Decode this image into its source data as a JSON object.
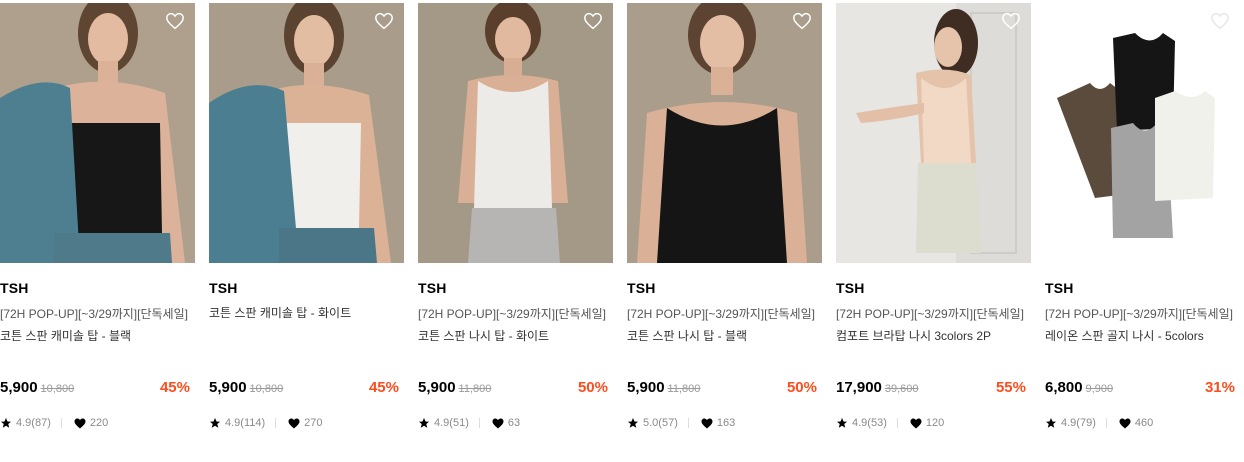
{
  "colors": {
    "discount": "#ff4c1d",
    "accent": "#000000"
  },
  "products": [
    {
      "brand": "TSH",
      "promo": "[72H POP-UP][~3/29까지][단독세일]",
      "name": "코튼 스판 캐미솔 탑 - 블랙",
      "price": "5,900",
      "original_price": "10,800",
      "discount": "45%",
      "rating": "4.9(87)",
      "likes": "220",
      "icon": "heart-outline-icon"
    },
    {
      "brand": "TSH",
      "promo": "",
      "name": "코튼 스판 캐미솔 탑 - 화이트",
      "price": "5,900",
      "original_price": "10,800",
      "discount": "45%",
      "rating": "4.9(114)",
      "likes": "270",
      "icon": "heart-outline-icon"
    },
    {
      "brand": "TSH",
      "promo": "[72H POP-UP][~3/29까지][단독세일]",
      "name": "코튼 스판 나시 탑 - 화이트",
      "price": "5,900",
      "original_price": "11,800",
      "discount": "50%",
      "rating": "4.9(51)",
      "likes": "63",
      "icon": "heart-outline-icon"
    },
    {
      "brand": "TSH",
      "promo": "[72H POP-UP][~3/29까지][단독세일]",
      "name": "코튼 스판 나시 탑 - 블랙",
      "price": "5,900",
      "original_price": "11,800",
      "discount": "50%",
      "rating": "5.0(57)",
      "likes": "163",
      "icon": "heart-outline-icon"
    },
    {
      "brand": "TSH",
      "promo": "[72H POP-UP][~3/29까지][단독세일]",
      "name": "컴포트 브라탑 나시 3colors 2P",
      "price": "17,900",
      "original_price": "39,600",
      "discount": "55%",
      "rating": "4.9(53)",
      "likes": "120",
      "icon": "heart-outline-icon"
    },
    {
      "brand": "TSH",
      "promo": "[72H POP-UP][~3/29까지][단독세일]",
      "name": "레이온 스판 골지 나시 - 5colors",
      "price": "6,800",
      "original_price": "9,900",
      "discount": "31%",
      "rating": "4.9(79)",
      "likes": "460",
      "icon": "heart-outline-icon"
    }
  ]
}
